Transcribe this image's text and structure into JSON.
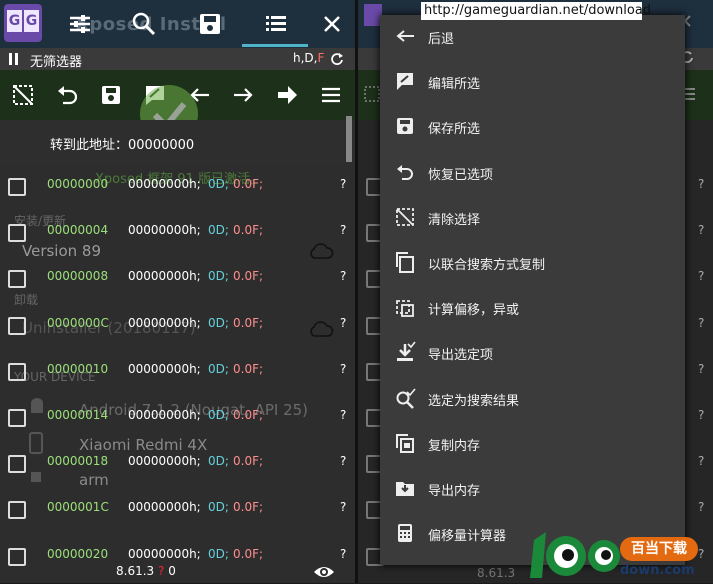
{
  "app": {
    "ghost_title": "Xposed Install",
    "filter_label": "无筛选器",
    "filter_flags_prefix": "h,D,",
    "filter_flags_accent": "F",
    "goto_label": "转到此地址：00000000",
    "version_text": "8.61.3",
    "version_badge": "?",
    "count": "0"
  },
  "ghost_overlay": {
    "xposed_status": "Xposed 框架 91 版已激活。",
    "install_update": "安装/更新",
    "version": "Version 89",
    "uninstall_header": "卸载",
    "uninstaller": "Uninstaller (20180117)",
    "your_device": "YOUR DEVICE",
    "android": "Android 7.1.2 (Nougat, API 25)",
    "device_model": "Xiaomi Redmi 4X",
    "arch": "arm"
  },
  "rows": [
    {
      "addr": "00000000",
      "hex": "00000000h;",
      "dec": "0D;",
      "float": "0.0F;",
      "q": "?"
    },
    {
      "addr": "00000004",
      "hex": "00000000h;",
      "dec": "0D;",
      "float": "0.0F;",
      "q": "?"
    },
    {
      "addr": "00000008",
      "hex": "00000000h;",
      "dec": "0D;",
      "float": "0.0F;",
      "q": "?"
    },
    {
      "addr": "0000000C",
      "hex": "00000000h;",
      "dec": "0D;",
      "float": "0.0F;",
      "q": "?"
    },
    {
      "addr": "00000010",
      "hex": "00000000h;",
      "dec": "0D;",
      "float": "0.0F;",
      "q": "?"
    },
    {
      "addr": "00000014",
      "hex": "00000000h;",
      "dec": "0D;",
      "float": "0.0F;",
      "q": "?"
    },
    {
      "addr": "00000018",
      "hex": "00000000h;",
      "dec": "0D;",
      "float": "0.0F;",
      "q": "?"
    },
    {
      "addr": "0000001C",
      "hex": "00000000h;",
      "dec": "0D;",
      "float": "0.0F;",
      "q": "?"
    },
    {
      "addr": "00000020",
      "hex": "00000000h;",
      "dec": "0D;",
      "float": "0.0F;",
      "q": "?"
    }
  ],
  "menu": {
    "items": [
      {
        "label": "后退",
        "icon": "back-arrow-icon"
      },
      {
        "label": "编辑所选",
        "icon": "edit-icon"
      },
      {
        "label": "保存所选",
        "icon": "save-icon"
      },
      {
        "label": "恢复已选项",
        "icon": "undo-icon"
      },
      {
        "label": "清除选择",
        "icon": "clear-selection-icon"
      },
      {
        "label": "以联合搜索方式复制",
        "icon": "copy-icon"
      },
      {
        "label": "计算偏移，异或",
        "icon": "offset-xor-icon"
      },
      {
        "label": "导出选定项",
        "icon": "export-selected-icon"
      },
      {
        "label": "选定为搜索结果",
        "icon": "search-check-icon"
      },
      {
        "label": "复制内存",
        "icon": "copy-memory-icon"
      },
      {
        "label": "导出内存",
        "icon": "export-memory-icon"
      },
      {
        "label": "偏移量计算器",
        "icon": "calculator-icon"
      }
    ]
  },
  "right_panel": {
    "version_text": "8.61.3"
  },
  "overlay": {
    "url": "http://gameguardian.net/download",
    "logo_text": "100",
    "download_badge": "百当下载",
    "download_domain": "down.com"
  },
  "colors": {
    "address": "#9be07a",
    "decimal": "#66d0d8",
    "float": "#ff8d8d",
    "toolbar_bg": "#1d3019",
    "header_bg": "#1e2f3e",
    "tab_underline": "#4fb4c8",
    "logo_purple": "#6a4aa8",
    "badge_orange": "#e36a10"
  }
}
